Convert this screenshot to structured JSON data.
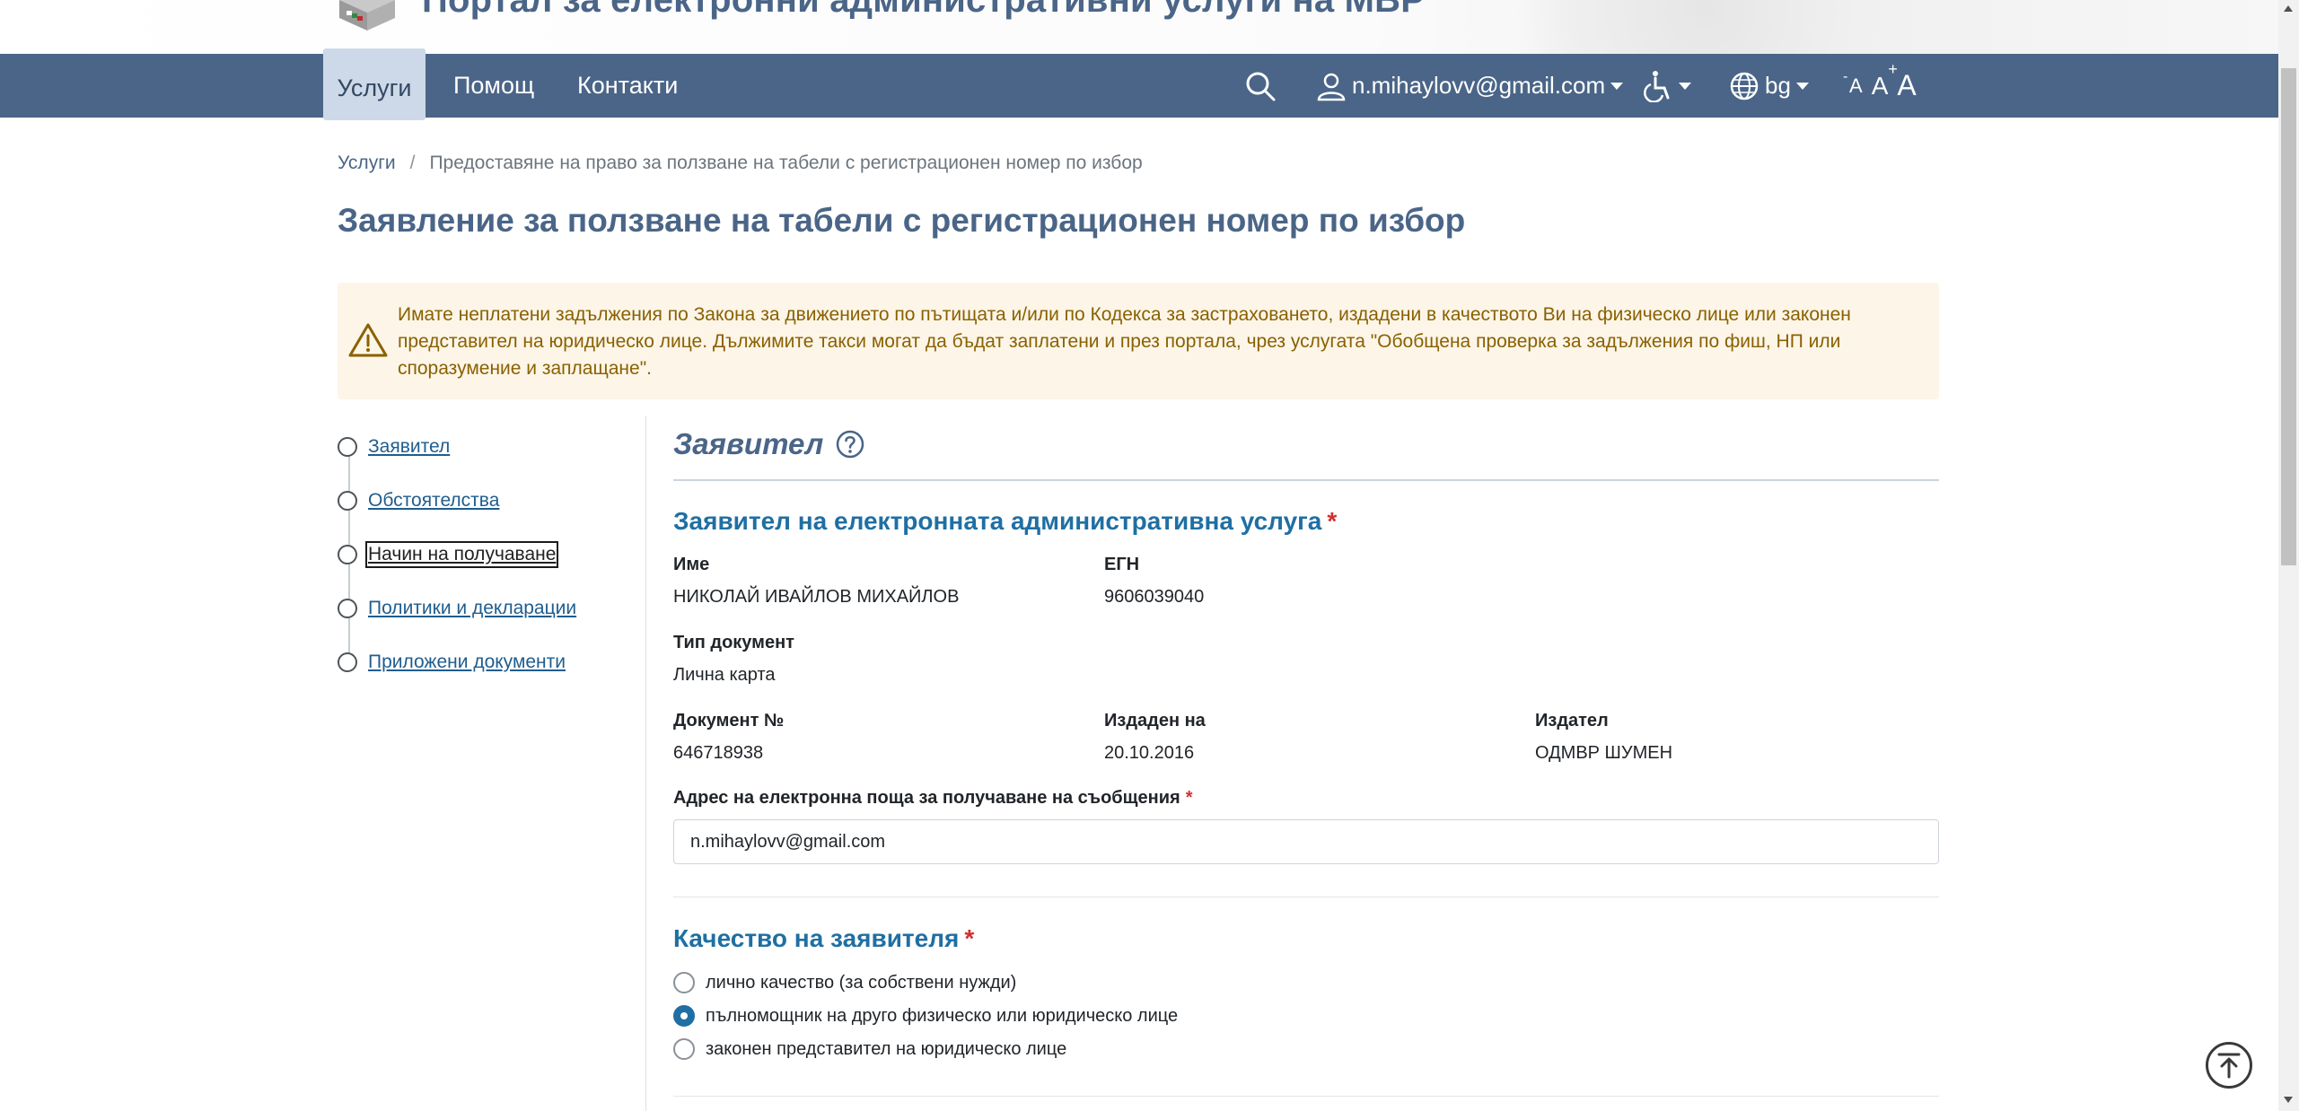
{
  "header": {
    "portal_title": "Портал за електронни административни услуги на МВР"
  },
  "nav": {
    "items": [
      {
        "label": "Услуги",
        "active": true
      },
      {
        "label": "Помощ"
      },
      {
        "label": "Контакти"
      }
    ],
    "user_email": "n.mihaylovv@gmail.com",
    "language": "bg",
    "icons": [
      "search-icon",
      "user-icon",
      "accessibility-icon",
      "globe-icon",
      "font-size-icons"
    ]
  },
  "breadcrumb": {
    "root": "Услуги",
    "separator": "/",
    "current": "Предоставяне на право за ползване на табели с регистрационен номер по избор"
  },
  "page_title": "Заявление за ползване на табели с регистрационен номер по избор",
  "alert": {
    "icon": "warning-icon",
    "text": "Имате неплатени задължения по Закона за движението по пътищата и/или по Кодекса за застраховането, издадени в качеството Ви на физическо лице или законен представител на юридическо лице. Дължимите такси могат да бъдат заплатени и през портала, чрез услугата \"Обобщена проверка за задължения по фиш, НП или споразумение и заплащане\"."
  },
  "steps": [
    {
      "label": "Заявител"
    },
    {
      "label": "Обстоятелства"
    },
    {
      "label": "Начин на получаване",
      "focused": true
    },
    {
      "label": "Политики и декларации"
    },
    {
      "label": "Приложени документи"
    }
  ],
  "section": {
    "title": "Заявител",
    "applicant_heading": "Заявител на електронната административна услуга",
    "required_mark": "*",
    "fields": {
      "name_label": "Име",
      "name_value": "НИКОЛАЙ ИВАЙЛОВ МИХАЙЛОВ",
      "egn_label": "ЕГН",
      "egn_value": "9606039040",
      "doctype_label": "Тип документ",
      "doctype_value": "Лична карта",
      "docno_label": "Документ №",
      "docno_value": "646718938",
      "issued_label": "Издаден на",
      "issued_value": "20.10.2016",
      "issuer_label": "Издател",
      "issuer_value": "ОДМВР ШУМЕН",
      "email_label": "Адрес на електронна поща за получаване на съобщения",
      "email_value": "n.mihaylovv@gmail.com"
    },
    "quality_heading": "Качество на заявителя",
    "quality_options": [
      {
        "label": "лично качество (за собствени нужди)",
        "checked": false
      },
      {
        "label": "пълномощник на друго физическо или юридическо лице",
        "checked": true
      },
      {
        "label": "законен представител на юридическо лице",
        "checked": false
      }
    ]
  },
  "colors": {
    "nav_bg": "#4a6587",
    "accent_blue": "#1f6fa3",
    "alert_bg": "#fcf5e8",
    "alert_text": "#8a6100",
    "required": "#d32f2f"
  }
}
